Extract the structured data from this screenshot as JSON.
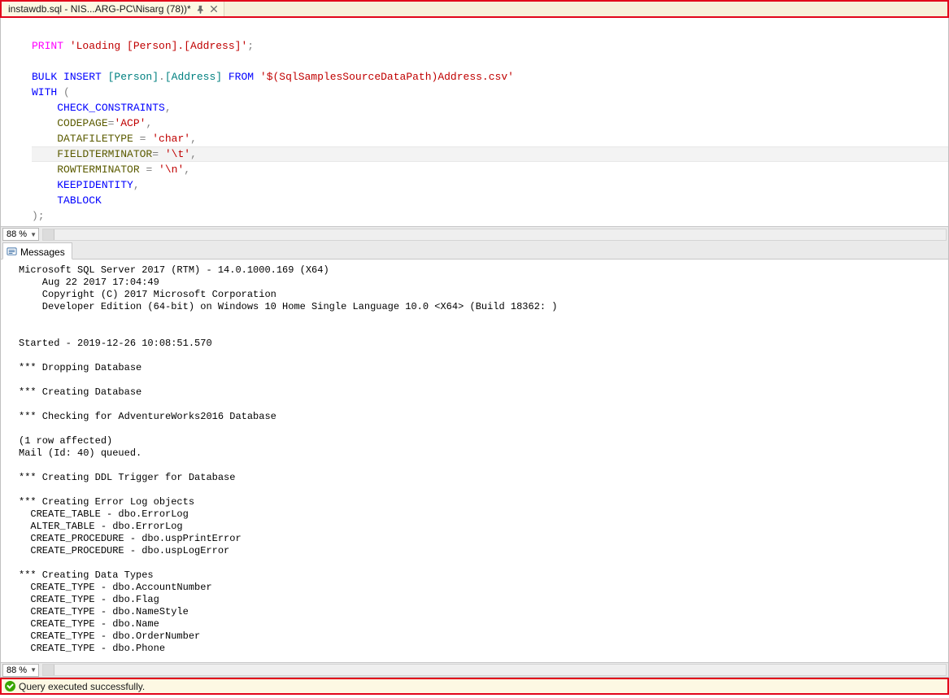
{
  "tab": {
    "title": "instawdb.sql - NIS...ARG-PC\\Nisarg (78))*"
  },
  "zoom": {
    "value": "88 %"
  },
  "code": {
    "l1": {
      "a": "PRINT ",
      "b": "'Loading [Person].[Address]'",
      "c": ";"
    },
    "l3": {
      "a": "BULK ",
      "b": "INSERT ",
      "c": "[Person]",
      "d": ".",
      "e": "[Address]",
      "f": " FROM ",
      "g": "'$(SqlSamplesSourceDataPath)Address.csv'"
    },
    "l4": {
      "a": "WITH ",
      "b": "("
    },
    "l5": {
      "a": "CHECK_CONSTRAINTS",
      "b": ","
    },
    "l6": {
      "a": "CODEPAGE",
      "b": "=",
      "c": "'ACP'",
      "d": ","
    },
    "l7": {
      "a": "DATAFILETYPE ",
      "b": "= ",
      "c": "'char'",
      "d": ","
    },
    "l8": {
      "a": "FIELDTERMINATOR",
      "b": "= ",
      "c": "'\\t'",
      "d": ","
    },
    "l9": {
      "a": "ROWTERMINATOR ",
      "b": "= ",
      "c": "'\\n'",
      "d": ","
    },
    "l10": {
      "a": "KEEPIDENTITY",
      "b": ","
    },
    "l11": {
      "a": "TABLOCK"
    },
    "l12": {
      "a": ");"
    }
  },
  "messagesTab": "Messages",
  "messages": "Microsoft SQL Server 2017 (RTM) - 14.0.1000.169 (X64)\n    Aug 22 2017 17:04:49\n    Copyright (C) 2017 Microsoft Corporation\n    Developer Edition (64-bit) on Windows 10 Home Single Language 10.0 <X64> (Build 18362: )\n\n\nStarted - 2019-12-26 10:08:51.570\n\n*** Dropping Database\n\n*** Creating Database\n\n*** Checking for AdventureWorks2016 Database\n\n(1 row affected)\nMail (Id: 40) queued.\n\n*** Creating DDL Trigger for Database\n\n*** Creating Error Log objects\n  CREATE_TABLE - dbo.ErrorLog\n  ALTER_TABLE - dbo.ErrorLog\n  CREATE_PROCEDURE - dbo.uspPrintError\n  CREATE_PROCEDURE - dbo.uspLogError\n\n*** Creating Data Types\n  CREATE_TYPE - dbo.AccountNumber\n  CREATE_TYPE - dbo.Flag\n  CREATE_TYPE - dbo.NameStyle\n  CREATE_TYPE - dbo.Name\n  CREATE_TYPE - dbo.OrderNumber\n  CREATE_TYPE - dbo.Phone",
  "status": {
    "text": "Query executed successfully."
  }
}
